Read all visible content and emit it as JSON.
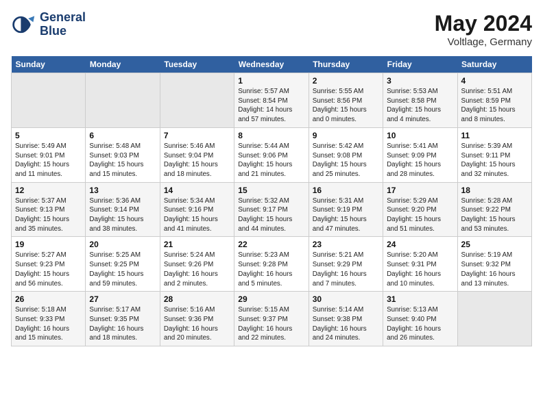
{
  "logo": {
    "name_line1": "General",
    "name_line2": "Blue"
  },
  "title": "May 2024",
  "location": "Voltlage, Germany",
  "weekdays": [
    "Sunday",
    "Monday",
    "Tuesday",
    "Wednesday",
    "Thursday",
    "Friday",
    "Saturday"
  ],
  "weeks": [
    [
      {
        "day": "",
        "info": ""
      },
      {
        "day": "",
        "info": ""
      },
      {
        "day": "",
        "info": ""
      },
      {
        "day": "1",
        "info": "Sunrise: 5:57 AM\nSunset: 8:54 PM\nDaylight: 14 hours\nand 57 minutes."
      },
      {
        "day": "2",
        "info": "Sunrise: 5:55 AM\nSunset: 8:56 PM\nDaylight: 15 hours\nand 0 minutes."
      },
      {
        "day": "3",
        "info": "Sunrise: 5:53 AM\nSunset: 8:58 PM\nDaylight: 15 hours\nand 4 minutes."
      },
      {
        "day": "4",
        "info": "Sunrise: 5:51 AM\nSunset: 8:59 PM\nDaylight: 15 hours\nand 8 minutes."
      }
    ],
    [
      {
        "day": "5",
        "info": "Sunrise: 5:49 AM\nSunset: 9:01 PM\nDaylight: 15 hours\nand 11 minutes."
      },
      {
        "day": "6",
        "info": "Sunrise: 5:48 AM\nSunset: 9:03 PM\nDaylight: 15 hours\nand 15 minutes."
      },
      {
        "day": "7",
        "info": "Sunrise: 5:46 AM\nSunset: 9:04 PM\nDaylight: 15 hours\nand 18 minutes."
      },
      {
        "day": "8",
        "info": "Sunrise: 5:44 AM\nSunset: 9:06 PM\nDaylight: 15 hours\nand 21 minutes."
      },
      {
        "day": "9",
        "info": "Sunrise: 5:42 AM\nSunset: 9:08 PM\nDaylight: 15 hours\nand 25 minutes."
      },
      {
        "day": "10",
        "info": "Sunrise: 5:41 AM\nSunset: 9:09 PM\nDaylight: 15 hours\nand 28 minutes."
      },
      {
        "day": "11",
        "info": "Sunrise: 5:39 AM\nSunset: 9:11 PM\nDaylight: 15 hours\nand 32 minutes."
      }
    ],
    [
      {
        "day": "12",
        "info": "Sunrise: 5:37 AM\nSunset: 9:13 PM\nDaylight: 15 hours\nand 35 minutes."
      },
      {
        "day": "13",
        "info": "Sunrise: 5:36 AM\nSunset: 9:14 PM\nDaylight: 15 hours\nand 38 minutes."
      },
      {
        "day": "14",
        "info": "Sunrise: 5:34 AM\nSunset: 9:16 PM\nDaylight: 15 hours\nand 41 minutes."
      },
      {
        "day": "15",
        "info": "Sunrise: 5:32 AM\nSunset: 9:17 PM\nDaylight: 15 hours\nand 44 minutes."
      },
      {
        "day": "16",
        "info": "Sunrise: 5:31 AM\nSunset: 9:19 PM\nDaylight: 15 hours\nand 47 minutes."
      },
      {
        "day": "17",
        "info": "Sunrise: 5:29 AM\nSunset: 9:20 PM\nDaylight: 15 hours\nand 51 minutes."
      },
      {
        "day": "18",
        "info": "Sunrise: 5:28 AM\nSunset: 9:22 PM\nDaylight: 15 hours\nand 53 minutes."
      }
    ],
    [
      {
        "day": "19",
        "info": "Sunrise: 5:27 AM\nSunset: 9:23 PM\nDaylight: 15 hours\nand 56 minutes."
      },
      {
        "day": "20",
        "info": "Sunrise: 5:25 AM\nSunset: 9:25 PM\nDaylight: 15 hours\nand 59 minutes."
      },
      {
        "day": "21",
        "info": "Sunrise: 5:24 AM\nSunset: 9:26 PM\nDaylight: 16 hours\nand 2 minutes."
      },
      {
        "day": "22",
        "info": "Sunrise: 5:23 AM\nSunset: 9:28 PM\nDaylight: 16 hours\nand 5 minutes."
      },
      {
        "day": "23",
        "info": "Sunrise: 5:21 AM\nSunset: 9:29 PM\nDaylight: 16 hours\nand 7 minutes."
      },
      {
        "day": "24",
        "info": "Sunrise: 5:20 AM\nSunset: 9:31 PM\nDaylight: 16 hours\nand 10 minutes."
      },
      {
        "day": "25",
        "info": "Sunrise: 5:19 AM\nSunset: 9:32 PM\nDaylight: 16 hours\nand 13 minutes."
      }
    ],
    [
      {
        "day": "26",
        "info": "Sunrise: 5:18 AM\nSunset: 9:33 PM\nDaylight: 16 hours\nand 15 minutes."
      },
      {
        "day": "27",
        "info": "Sunrise: 5:17 AM\nSunset: 9:35 PM\nDaylight: 16 hours\nand 18 minutes."
      },
      {
        "day": "28",
        "info": "Sunrise: 5:16 AM\nSunset: 9:36 PM\nDaylight: 16 hours\nand 20 minutes."
      },
      {
        "day": "29",
        "info": "Sunrise: 5:15 AM\nSunset: 9:37 PM\nDaylight: 16 hours\nand 22 minutes."
      },
      {
        "day": "30",
        "info": "Sunrise: 5:14 AM\nSunset: 9:38 PM\nDaylight: 16 hours\nand 24 minutes."
      },
      {
        "day": "31",
        "info": "Sunrise: 5:13 AM\nSunset: 9:40 PM\nDaylight: 16 hours\nand 26 minutes."
      },
      {
        "day": "",
        "info": ""
      }
    ]
  ]
}
